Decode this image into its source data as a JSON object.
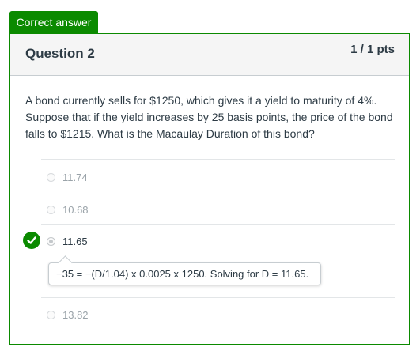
{
  "status_tag": "Correct answer",
  "question": {
    "title": "Question 2",
    "points": "1 / 1 pts",
    "text": "A bond currently sells for $1250, which gives it a yield to maturity of 4%. Suppose that if the yield increases by 25 basis points, the price of the bond falls to $1215. What is the Macaulay Duration of this bond?"
  },
  "answers": [
    {
      "label": "11.74",
      "selected": false,
      "correct": false
    },
    {
      "label": "10.68",
      "selected": false,
      "correct": false
    },
    {
      "label": "11.65",
      "selected": true,
      "correct": true
    },
    {
      "label": "13.82",
      "selected": false,
      "correct": false
    }
  ],
  "answer_comment": "−35 = −(D/1.04) x 0.0025 x 1250. Solving for D = 11.65.",
  "colors": {
    "correct_green": "#0b8a00",
    "header_bg": "#f5f5f5",
    "text": "#2d3b45"
  },
  "icons": {
    "correct_marker": "check-icon"
  }
}
